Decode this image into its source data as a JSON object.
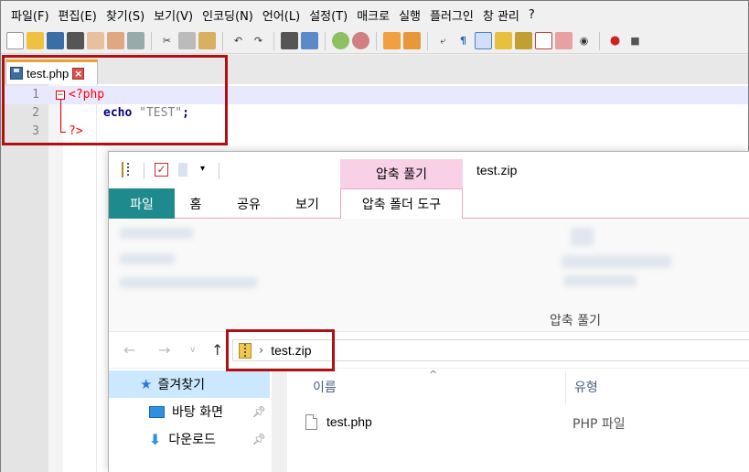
{
  "menu": [
    "파일(F)",
    "편집(E)",
    "찾기(S)",
    "보기(V)",
    "인코딩(N)",
    "언어(L)",
    "설정(T)",
    "매크로",
    "실행",
    "플러그인",
    "창 관리",
    "?"
  ],
  "tab": {
    "name": "test.php"
  },
  "editor": {
    "lines": [
      {
        "num": "1",
        "text": "<?php"
      },
      {
        "num": "2",
        "keyword": "echo",
        "string": "\"TEST\"",
        "end": ";"
      },
      {
        "num": "3",
        "text": "?>"
      }
    ]
  },
  "explorer": {
    "title": "test.zip",
    "context_tab_header": "압축 풀기",
    "ribbon_tabs": {
      "file": "파일",
      "home": "홈",
      "share": "공유",
      "view": "보기",
      "context": "압축 폴더 도구"
    },
    "ribbon_group_label": "압축 풀기",
    "address": {
      "path": "test.zip",
      "chevron": "›"
    },
    "nav_pane": {
      "favorites": "즐겨찾기",
      "items": [
        {
          "label": "바탕 화면"
        },
        {
          "label": "다운로드"
        }
      ]
    },
    "columns": {
      "name": "이름",
      "type": "유형"
    },
    "files": [
      {
        "name": "test.php",
        "type": "PHP 파일"
      }
    ]
  },
  "colors": {
    "highlight": "#b01010",
    "file_tab": "#1f8a8e",
    "context_tab": "#f8d1e6",
    "php_tag": "#ff0000",
    "keyword": "#000080"
  }
}
